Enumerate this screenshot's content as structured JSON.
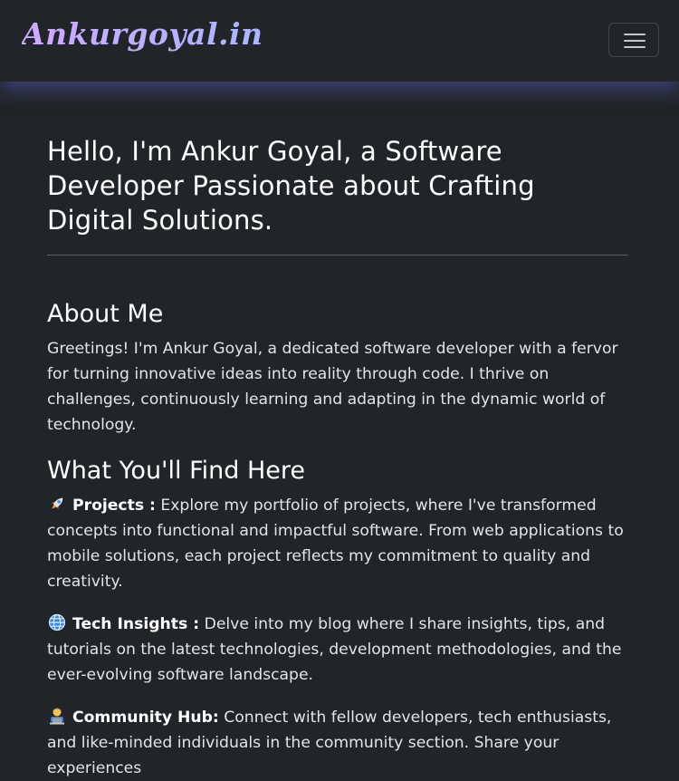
{
  "navbar": {
    "brand": "Ankurgoyal.in",
    "toggler_icon": "hamburger-icon"
  },
  "hero": {
    "title": "Hello, I'm Ankur Goyal, a Software Developer Passionate about Crafting Digital Solutions."
  },
  "about": {
    "heading": "About Me",
    "text": "Greetings! I'm Ankur Goyal, a dedicated software developer with a fervor for turning innovative ideas into reality through code. I thrive on challenges, continuously learning and adapting in the dynamic world of technology."
  },
  "find_here": {
    "heading": "What You'll Find Here",
    "items": [
      {
        "icon": "rocket-icon",
        "title": "Projects :",
        "text": "Explore my portfolio of projects, where I've transformed concepts into functional and impactful software. From web applications to mobile solutions, each project reflects my commitment to quality and creativity."
      },
      {
        "icon": "globe-icon",
        "title": "Tech Insights :",
        "text": "Delve into my blog where I share insights, tips, and tutorials on the latest technologies, development methodologies, and the ever-evolving software landscape."
      },
      {
        "icon": "technologist-icon",
        "title": "Community Hub:",
        "text": "Connect with fellow developers, tech enthusiasts, and like-minded individuals in the community section. Share your experiences"
      }
    ]
  },
  "colors": {
    "background": "#212529",
    "brand_gradient_start": "#d0a8ff",
    "brand_gradient_end": "#a9b7ff",
    "nav_glow": "#5a64d2"
  }
}
